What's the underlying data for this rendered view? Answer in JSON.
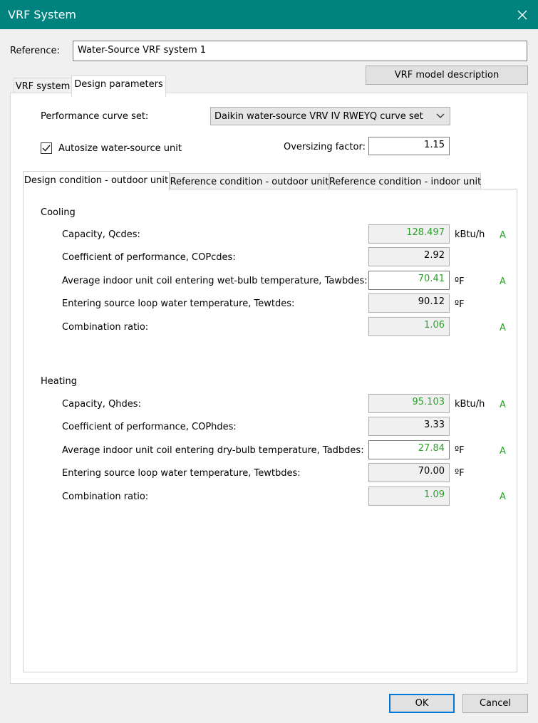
{
  "window": {
    "title": "VRF System"
  },
  "reference": {
    "label": "Reference:",
    "value": "Water-Source VRF system 1"
  },
  "buttons": {
    "model_description": "VRF model description",
    "ok": "OK",
    "cancel": "Cancel"
  },
  "tabs": [
    {
      "label": "VRF system",
      "active": false
    },
    {
      "label": "Design parameters",
      "active": true
    }
  ],
  "design": {
    "curve_set_label": "Performance curve set:",
    "curve_set_value": "Daikin water-source VRV IV RWEYQ curve set",
    "autosize_label": "Autosize water-source unit",
    "autosize_checked": true,
    "oversizing_label": "Oversizing factor:",
    "oversizing_value": "1.15"
  },
  "subtabs": [
    {
      "label": "Design condition - outdoor unit",
      "active": true
    },
    {
      "label": "Reference condition - outdoor unit",
      "active": false
    },
    {
      "label": "Reference condition - indoor unit",
      "active": false
    }
  ],
  "cooling": {
    "heading": "Cooling",
    "rows": [
      {
        "label": "Capacity, Qcdes:",
        "value": "128.497",
        "unit": "kBtu/h",
        "flag": "A"
      },
      {
        "label": "Coefficient of performance, COPcdes:",
        "value": "2.92",
        "unit": "",
        "flag": ""
      },
      {
        "label": "Average indoor unit coil entering wet-bulb temperature, Tawbdes:",
        "value": "70.41",
        "unit": "ºF",
        "flag": "A"
      },
      {
        "label": "Entering source loop water temperature, Tewtdes:",
        "value": "90.12",
        "unit": "ºF",
        "flag": ""
      },
      {
        "label": "Combination ratio:",
        "value": "1.06",
        "unit": "",
        "flag": "A"
      }
    ]
  },
  "heating": {
    "heading": "Heating",
    "rows": [
      {
        "label": "Capacity, Qhdes:",
        "value": "95.103",
        "unit": "kBtu/h",
        "flag": "A"
      },
      {
        "label": "Coefficient of performance, COPhdes:",
        "value": "3.33",
        "unit": "",
        "flag": ""
      },
      {
        "label": "Average indoor unit coil entering dry-bulb temperature, Tadbdes:",
        "value": "27.84",
        "unit": "ºF",
        "flag": "A"
      },
      {
        "label": "Entering source loop water temperature, Tewtbdes:",
        "value": "70.00",
        "unit": "ºF",
        "flag": ""
      },
      {
        "label": "Combination ratio:",
        "value": "1.09",
        "unit": "",
        "flag": "A"
      }
    ]
  },
  "colors": {
    "titlebar": "#00827f",
    "autosized_text": "#2ca02c",
    "focus_border": "#0078d7"
  }
}
